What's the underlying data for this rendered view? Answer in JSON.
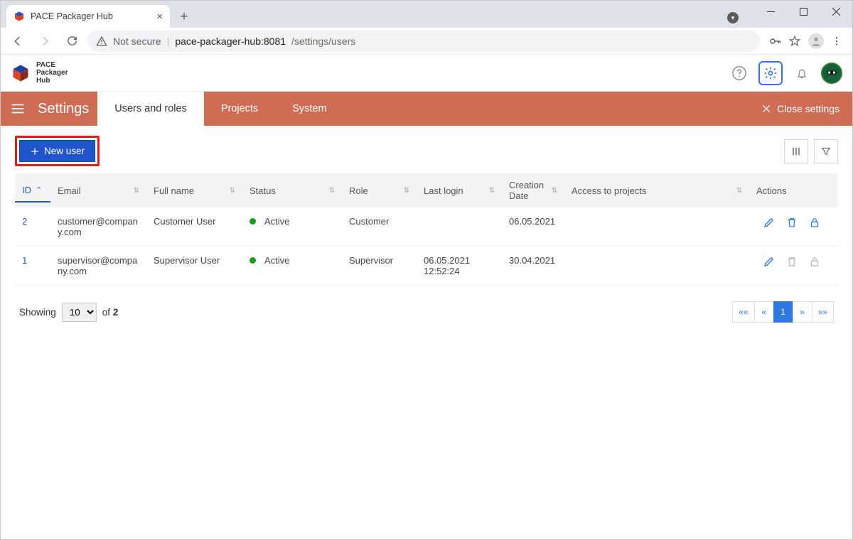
{
  "browser": {
    "tab_title": "PACE Packager Hub",
    "url_host": "pace-packager-hub:8081",
    "url_path": "/settings/users",
    "not_secure_label": "Not secure"
  },
  "logo": {
    "line1": "PACE",
    "line2": "Packager",
    "line3": "Hub"
  },
  "nav": {
    "title": "Settings",
    "tabs": {
      "users": "Users and roles",
      "projects": "Projects",
      "system": "System"
    },
    "close": "Close settings"
  },
  "toolbar": {
    "new_user": "New user"
  },
  "table": {
    "headers": {
      "id": "ID",
      "email": "Email",
      "full_name": "Full name",
      "status": "Status",
      "role": "Role",
      "last_login": "Last login",
      "creation_date": "Creation Date",
      "access": "Access to projects",
      "actions": "Actions"
    },
    "rows": [
      {
        "id": "2",
        "email": "customer@company.com",
        "full_name": "Customer User",
        "status": "Active",
        "role": "Customer",
        "last_login": "",
        "creation_date": "06.05.2021",
        "actions_muted": false
      },
      {
        "id": "1",
        "email": "supervisor@company.com",
        "full_name": "Supervisor User",
        "status": "Active",
        "role": "Supervisor",
        "last_login": "06.05.2021 12:52:24",
        "creation_date": "30.04.2021",
        "actions_muted": true
      }
    ]
  },
  "pager": {
    "showing": "Showing",
    "of": "of",
    "total": "2",
    "page_size_options": [
      "10"
    ],
    "current_size": "10",
    "first": "««",
    "prev": "«",
    "page": "1",
    "next": "»",
    "last": "»»"
  }
}
